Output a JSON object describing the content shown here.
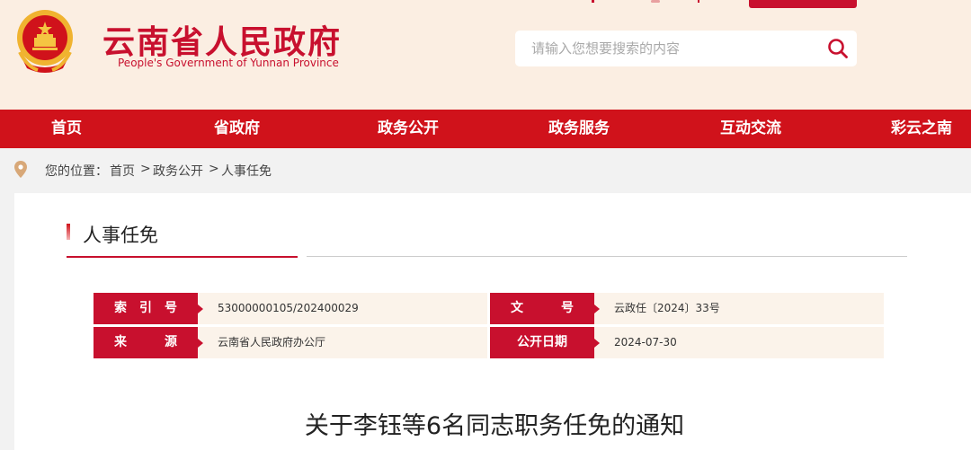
{
  "header": {
    "title": "云南省人民政府",
    "subtitle": "People's Government of Yunnan Province",
    "emblem_icon": "national-emblem-icon",
    "search": {
      "placeholder": "请输入您想要搜索的内容",
      "icon": "search-icon"
    }
  },
  "nav": [
    {
      "label": "首页"
    },
    {
      "label": "省政府"
    },
    {
      "label": "政务公开"
    },
    {
      "label": "政务服务"
    },
    {
      "label": "互动交流"
    },
    {
      "label": "彩云之南"
    }
  ],
  "breadcrumb": {
    "prefix": "您的位置：",
    "items": [
      "首页",
      "政务公开",
      "人事任免"
    ],
    "separator": ">"
  },
  "section": {
    "title": "人事任免"
  },
  "info": {
    "index_label": "索　引　号",
    "index_value": "53000000105/202400029",
    "docno_label": "文　　　号",
    "docno_value": "云政任〔2024〕33号",
    "source_label": "来　　　源",
    "source_value": "云南省人民政府办公厅",
    "date_label": "公开日期",
    "date_value": "2024-07-30"
  },
  "document": {
    "title": "关于李钰等6名同志职务任免的通知"
  },
  "colors": {
    "brand_red": "#d0121b",
    "header_bg": "#fbeee2",
    "info_bg": "#fbf3ea"
  }
}
